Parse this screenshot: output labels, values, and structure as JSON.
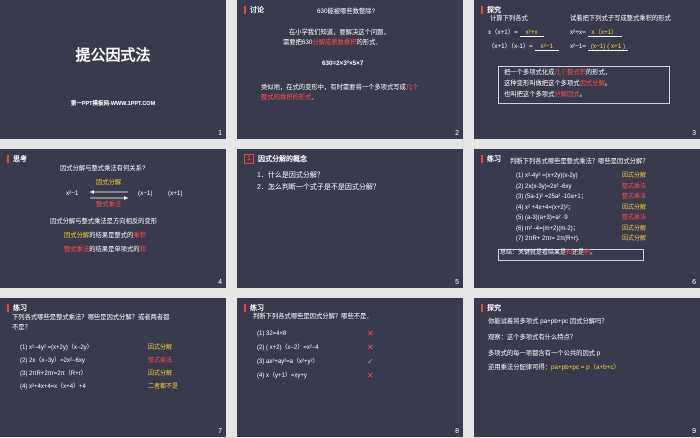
{
  "slides": [
    {
      "num": "1",
      "title": "提公因式法",
      "footer": "第一PPT模板网-WWW.1PPT.COM"
    },
    {
      "num": "2",
      "header": "讨论",
      "question": "630能被哪些数整除?",
      "l1": "在小学我们知道，要解决这个问题，",
      "l2a": "需要把630",
      "l2b": "分解成质数乘积",
      "l2c": "的形式．",
      "equation": "630=2×3²×5×7",
      "l3a": "类似地，在式的变形中，有时需要将一个多项式写成",
      "l3b": "几个",
      "l4a": "整式的乘积的形式",
      "l4b": "．"
    },
    {
      "num": "3",
      "header": "探究",
      "sub": "计算下列各式",
      "e1": "x（x+1）=",
      "e1a": "x²+x",
      "e2": "（x+1）（x-1）=",
      "e2a": "x²−1",
      "right_title": "试着把下列式子写成整式乘积的形式",
      "r1": "x²+x=",
      "r1a": "x（x+1）",
      "r2": "x²−1=",
      "r2a": "(x−1)  ( x+1 )",
      "b1a": "把一个多项式化成",
      "b1b": "几个整式积",
      "b1c": "的形式，",
      "b2a": "这种变形叫做把这个多项式",
      "b2b": "因式分解",
      "b2c": "。",
      "b3a": "也叫把这个多项式",
      "b3b": "分解因式",
      "b3c": "。"
    },
    {
      "num": "4",
      "header": "思考",
      "q": "因式分解与整式乘法有何关系?",
      "lhs": "x²−1",
      "top": "因式分解",
      "f1": "(x−1)",
      "f2": "(x+1)",
      "bottom": "整式乘法",
      "s1": "因式分解与整式乘法是方向相反的变形",
      "s2a": "因式分解",
      "s2b": "的结果是整式的",
      "s2c": "乘积",
      "s3a": "整式乘法",
      "s3b": "的结果是单项式的",
      "s3c": "和"
    },
    {
      "num": "5",
      "header": "因式分解的概念",
      "q1": "1．什么是因式分解？",
      "q2": "2．怎么判断一个式子是不是因式分解？"
    },
    {
      "num": "6",
      "header": "练习",
      "q": "判断下列各式哪些是整式乘法？哪些是因式分解？",
      "items": [
        {
          "text": "(1) x²-4y² =(x+2y)(x-2y)",
          "ans": "因式分解",
          "c": "y"
        },
        {
          "text": "(2) 2x(x-3y)=2x² -6xy",
          "ans": "整式乘法",
          "c": "r"
        },
        {
          "text": "(3) (5a-1)² =25a² -10a+1；",
          "ans": "整式乘法",
          "c": "r"
        },
        {
          "text": "(4) x² +4x+4=(x+2)²；",
          "ans": "因式分解",
          "c": "y"
        },
        {
          "text": "(5) (a-3)(a+3)=a² -9",
          "ans": "整式乘法",
          "c": "r"
        },
        {
          "text": "(6) m² -4=(m+2)(m-2)；",
          "ans": "因式分解",
          "c": "y"
        },
        {
          "text": "(7) 2πR+ 2πr= 2π(R+r).",
          "ans": "因式分解",
          "c": "y"
        }
      ],
      "summary_a": "总结：关键就是看结果是",
      "summary_b": "和",
      "summary_c": "还是",
      "summary_d": "积",
      "summary_e": "。"
    },
    {
      "num": "7",
      "header": "练习",
      "q1": "下列各式哪些是整式乘法？哪些是因式分解？或者两者都",
      "q2": "不是？",
      "items": [
        {
          "text": "(1) x²−4y² =(x+2y)（x−2y）",
          "ans": "因式分解",
          "c": "y"
        },
        {
          "text": "(2) 2x（x−3y）=2x²−6xy",
          "ans": "整式乘法",
          "c": "r"
        },
        {
          "text": "(3) 2πR+2πr=2π（R+r）",
          "ans": "因式分解",
          "c": "y"
        },
        {
          "text": "(4) x²+4x+4=x（x+4）+4",
          "ans": "二者都不是",
          "c": "y"
        }
      ]
    },
    {
      "num": "8",
      "header": "练习",
      "q": "判断下列各式哪些是因式分解？哪些不是．",
      "items": [
        {
          "text": "(1)  32=4×8",
          "mark": "✕",
          "c": "r"
        },
        {
          "text": "(2)  ( x+2)（x−2）=x²−4",
          "mark": "✕",
          "c": "r"
        },
        {
          "text": "(3)  ax²+ay²=a（x²+y²）",
          "mark": "✓",
          "c": "g"
        },
        {
          "text": "(4)  x（y+1）=xy+y",
          "mark": "✕",
          "c": "r"
        }
      ]
    },
    {
      "num": "9",
      "header": "探究",
      "l1": "你能试着将多项式 pa+pb+pc 因式分解吗？",
      "l2": "观察：这个多项式有什么特点？",
      "l3": "多项式的每一项都含有一个公共的因式 p",
      "l4a": "逆用乘法分配律可得：",
      "l4b": "pa+pb+pc = p（a+b+c）"
    }
  ]
}
